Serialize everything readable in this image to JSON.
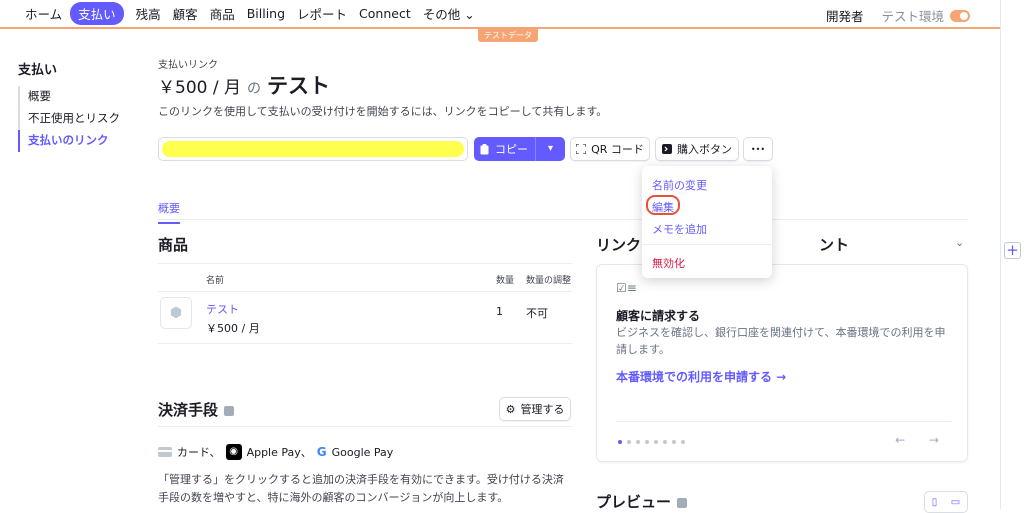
{
  "topnav": {
    "items": [
      "ホーム",
      "支払い",
      "残高",
      "顧客",
      "商品",
      "Billing",
      "レポート",
      "Connect",
      "その他"
    ],
    "more_chevron": "⌄",
    "developers": "開発者",
    "test_mode": "テスト環境",
    "test_badge": "テストデータ",
    "accent": "#635bff",
    "test_color": "#f5a573"
  },
  "sidebar": {
    "title": "支払い",
    "items": [
      "概要",
      "不正使用とリスク",
      "支払いのリンク"
    ]
  },
  "header": {
    "breadcrumb": "支払いリンク",
    "price": "￥500 / 月",
    "connector": "の",
    "name": "テスト",
    "description": "このリンクを使用して支払いの受け付けを開始するには、リンクをコピーして共有します。"
  },
  "actions": {
    "copy": "コピー",
    "qr": "QR コード",
    "buy_button": "購入ボタン",
    "more": "•••"
  },
  "dropdown": {
    "items": [
      "名前の変更",
      "編集",
      "メモを追加"
    ],
    "danger": "無効化"
  },
  "tabs": [
    "概要"
  ],
  "products": {
    "title": "商品",
    "headers": [
      "名前",
      "数量",
      "数量の調整"
    ],
    "row": {
      "name": "テスト",
      "price": "￥500 / 月",
      "qty": "1",
      "adjust": "不可"
    }
  },
  "payment": {
    "title": "決済手段",
    "manage": "管理する",
    "methods": [
      "カード、",
      "Apple Pay、",
      "Google Pay"
    ],
    "desc": "「管理する」をクリックすると追加の決済手段を有効にできます。受け付ける決済手段の数を増やすと、特に海外の顧客のコンバージョンが向上します。"
  },
  "checklist": {
    "title_visible": "リンク",
    "title_tail": "ント",
    "card_title": "顧客に請求する",
    "card_desc": "ビジネスを確認し、銀行口座を関連付けて、本番環境での利用を申請します。",
    "card_link": "本番環境での利用を申請する →",
    "arrows": "← →"
  },
  "preview": {
    "title": "プレビュー"
  }
}
